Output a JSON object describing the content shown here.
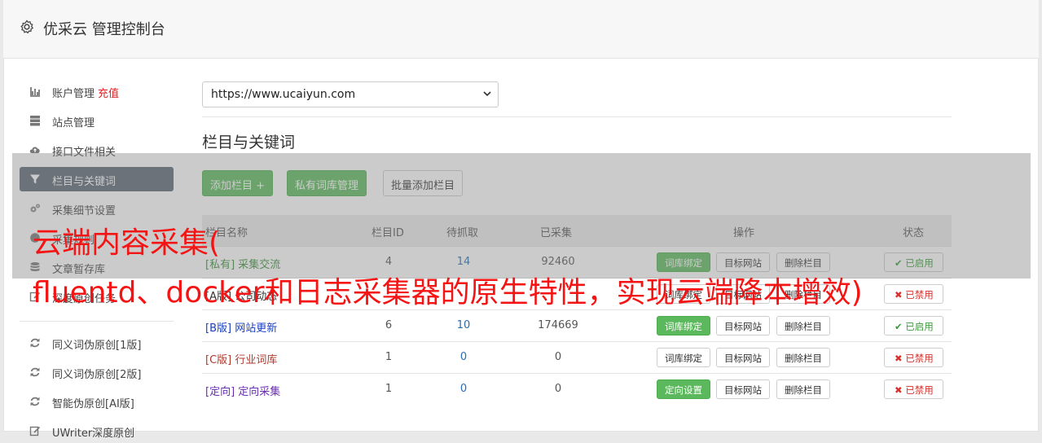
{
  "header": {
    "title": "优采云 管理控制台",
    "icon": "gear-icon"
  },
  "sidebar": {
    "items": [
      {
        "label": "账户管理",
        "extra": "充值",
        "icon": "bar-chart-icon"
      },
      {
        "label": "站点管理",
        "icon": "server-icon"
      },
      {
        "label": "接口文件相关",
        "icon": "cloud-upload-icon"
      },
      {
        "label": "栏目与关键词",
        "icon": "filter-icon",
        "active": true
      },
      {
        "label": "采集细节设置",
        "icon": "cogs-icon"
      },
      {
        "label": "采集规则",
        "icon": "globe-icon"
      },
      {
        "label": "文章暂存库",
        "icon": "database-icon"
      },
      {
        "label": "深度原创任务",
        "icon": "edit-icon"
      },
      {
        "label": "同义词伪原创[1版]",
        "icon": "refresh-icon"
      },
      {
        "label": "同义词伪原创[2版]",
        "icon": "refresh-icon"
      },
      {
        "label": "智能伪原创[AI版]",
        "icon": "refresh-icon"
      },
      {
        "label": "UWriter深度原创",
        "icon": "edit-icon"
      }
    ]
  },
  "site_select": {
    "value": "https://www.ucaiyun.com"
  },
  "section": {
    "title": "栏目与关键词"
  },
  "toolbar": {
    "add_column": "添加栏目 +",
    "private_lib": "私有词库管理",
    "batch_add": "批量添加栏目"
  },
  "table": {
    "headers": {
      "name": "栏目名称",
      "id": "栏目ID",
      "pending": "待抓取",
      "collected": "已采集",
      "ops": "操作",
      "status": "状态"
    },
    "rows": [
      {
        "tag": "[私有]",
        "name": "采集交流",
        "color": "#3c8d3c",
        "id": "4",
        "pending": "14",
        "collected": "92460",
        "op1": "词库绑定",
        "op1_green": true,
        "op2": "目标网站",
        "op3": "删除栏目",
        "status": "已启用",
        "enabled": true
      },
      {
        "tag": "[A版]",
        "name": "公司动态",
        "color": "#333333",
        "id": "",
        "pending": "",
        "collected": "",
        "op1": "词库绑定",
        "op1_green": false,
        "op2": "目标网站",
        "op3": "删除栏目",
        "status": "已禁用",
        "enabled": false
      },
      {
        "tag": "[B版]",
        "name": "网站更新",
        "color": "#1a3fbf",
        "id": "6",
        "pending": "10",
        "collected": "174669",
        "op1": "词库绑定",
        "op1_green": true,
        "op2": "目标网站",
        "op3": "删除栏目",
        "status": "已启用",
        "enabled": true
      },
      {
        "tag": "[C版]",
        "name": "行业词库",
        "color": "#b03a2e",
        "id": "1",
        "pending": "0",
        "collected": "0",
        "op1": "词库绑定",
        "op1_green": false,
        "op2": "目标网站",
        "op3": "删除栏目",
        "status": "已禁用",
        "enabled": false
      },
      {
        "tag": "[定向]",
        "name": "定向采集",
        "color": "#6a2fb0",
        "id": "1",
        "pending": "0",
        "collected": "0",
        "op1": "定向设置",
        "op1_green": true,
        "op2": "目标网站",
        "op3": "删除栏目",
        "status": "已禁用",
        "enabled": false
      }
    ]
  },
  "watermark": {
    "line1": "云端内容采集(",
    "line2": "fluentd、docker和日志采集器的原生特性，实现云端降本增效)"
  }
}
